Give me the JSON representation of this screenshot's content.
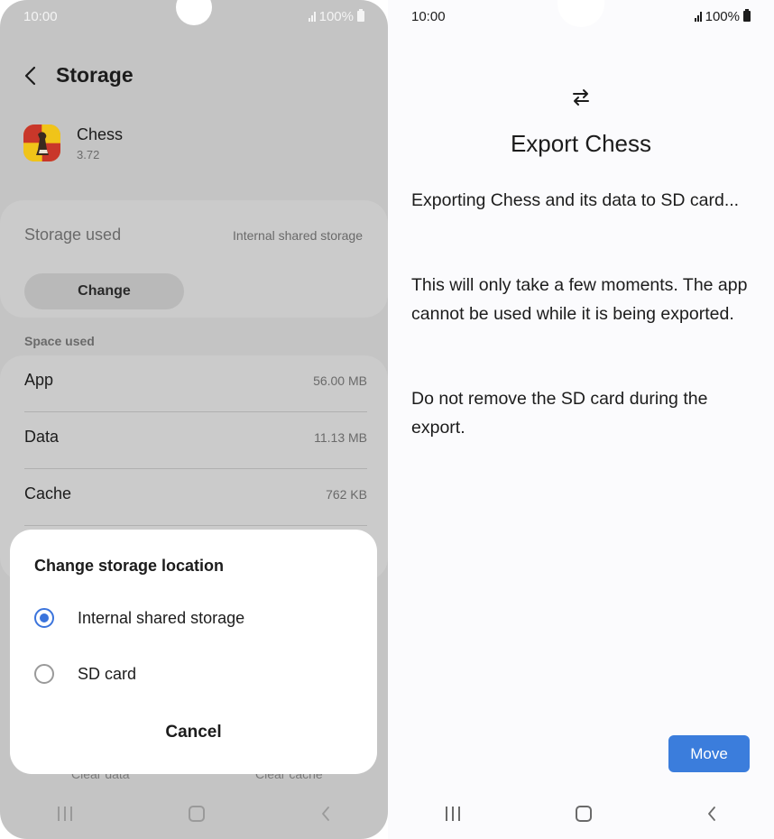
{
  "left": {
    "status": {
      "time": "10:00",
      "battery": "100%"
    },
    "header": {
      "title": "Storage"
    },
    "app": {
      "name": "Chess",
      "version": "3.72"
    },
    "storage": {
      "label": "Storage used",
      "value": "Internal shared storage",
      "change_label": "Change"
    },
    "space": {
      "section_label": "Space used",
      "rows": [
        {
          "label": "App",
          "value": "56.00 MB"
        },
        {
          "label": "Data",
          "value": "11.13 MB"
        },
        {
          "label": "Cache",
          "value": "762 KB"
        }
      ]
    },
    "bottom_actions": {
      "clear_data": "Clear data",
      "clear_cache": "Clear cache"
    },
    "dialog": {
      "title": "Change storage location",
      "options": [
        {
          "label": "Internal shared storage",
          "selected": true
        },
        {
          "label": "SD card",
          "selected": false
        }
      ],
      "cancel_label": "Cancel"
    }
  },
  "right": {
    "status": {
      "time": "10:00",
      "battery": "100%"
    },
    "title": "Export Chess",
    "paragraphs": [
      "Exporting Chess and its data to SD card...",
      "This will only take a few moments. The app cannot be used while it is being exported.",
      "Do not remove the SD card during the export."
    ],
    "move_label": "Move"
  },
  "colors": {
    "accent": "#3b7ddc",
    "overlay": "#c4c4c4"
  },
  "icons": [
    "back-chevron-icon",
    "chess-app-icon",
    "swap-arrows-icon",
    "signal-icon",
    "battery-icon",
    "nav-recents-icon",
    "nav-home-icon",
    "nav-back-icon"
  ]
}
